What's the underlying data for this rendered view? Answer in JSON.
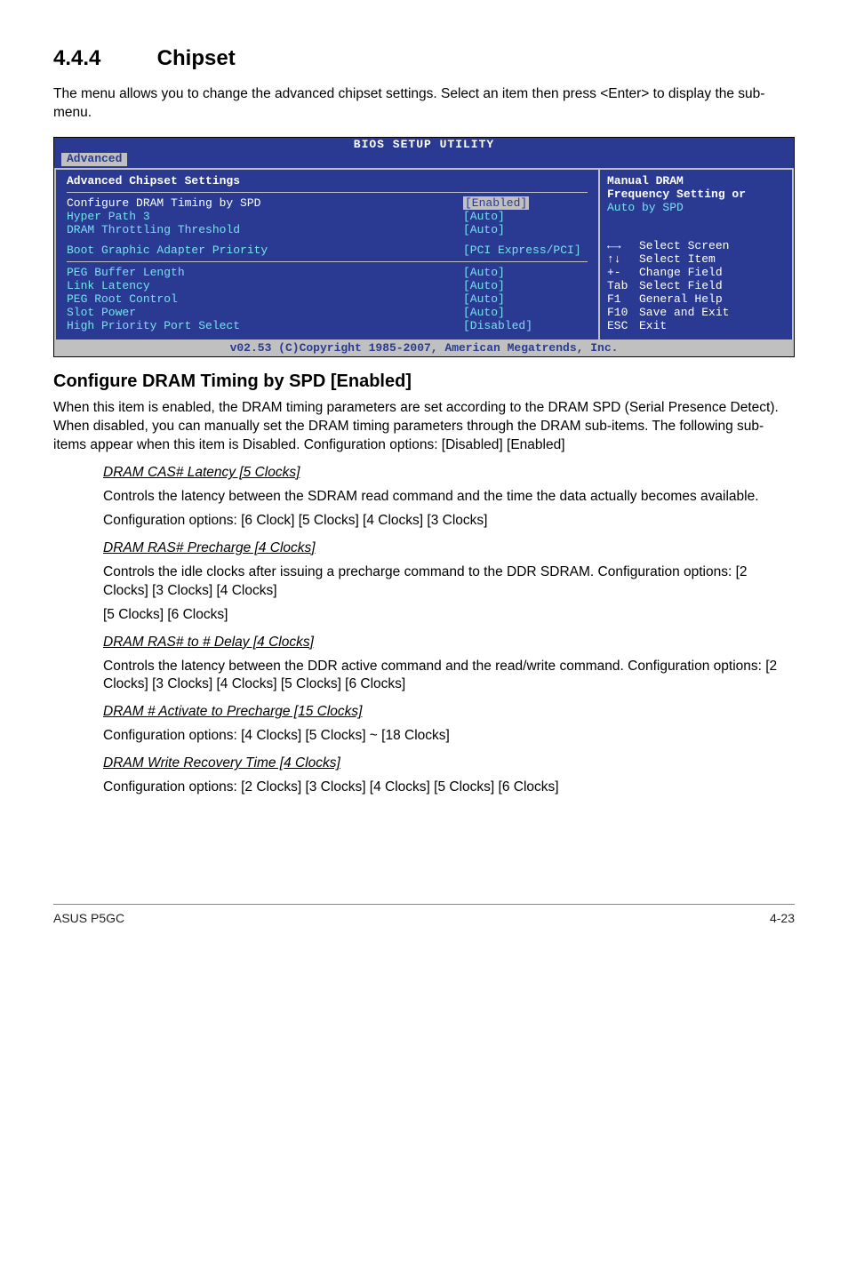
{
  "section": {
    "num": "4.4.4",
    "title": "Chipset"
  },
  "intro": "The menu allows you to change the advanced chipset settings. Select an item then press <Enter> to display the sub-menu.",
  "bios": {
    "title": "BIOS SETUP UTILITY",
    "tab": "Advanced",
    "panel_heading": "Advanced Chipset Settings",
    "top": [
      {
        "label": "Configure DRAM Timing by SPD",
        "value": "[Enabled]",
        "hl": true
      },
      {
        "label": "Hyper Path 3",
        "value": "[Auto]"
      },
      {
        "label": "DRAM Throttling Threshold",
        "value": "[Auto]"
      }
    ],
    "boot": {
      "label": "Boot Graphic Adapter Priority",
      "value": "[PCI Express/PCI]"
    },
    "bottom": [
      {
        "label": "PEG Buffer Length",
        "value": "[Auto]"
      },
      {
        "label": "Link Latency",
        "value": "[Auto]"
      },
      {
        "label": "PEG Root Control",
        "value": "[Auto]"
      },
      {
        "label": "Slot Power",
        "value": "[Auto]"
      },
      {
        "label": "High Priority Port Select",
        "value": "[Disabled]"
      }
    ],
    "help": {
      "l1": "Manual DRAM",
      "l2": "Frequency Setting or",
      "l3": "Auto by SPD"
    },
    "keys": [
      {
        "k": "←→",
        "d": "Select Screen"
      },
      {
        "k": "↑↓",
        "d": "Select Item"
      },
      {
        "k": "+-",
        "d": "Change Field"
      },
      {
        "k": "Tab",
        "d": "Select Field"
      },
      {
        "k": "F1",
        "d": "General Help"
      },
      {
        "k": "F10",
        "d": "Save and Exit"
      },
      {
        "k": "ESC",
        "d": "Exit"
      }
    ],
    "footer": "v02.53 (C)Copyright 1985-2007, American Megatrends, Inc."
  },
  "subheading": "Configure DRAM Timing by SPD [Enabled]",
  "subpara": "When this item is enabled, the DRAM timing parameters are set according to the DRAM SPD (Serial Presence Detect). When disabled, you can manually set the DRAM timing parameters through the DRAM sub-items. The following sub-items appear when this item is Disabled.  Configuration options: [Disabled] [Enabled]",
  "items": [
    {
      "title": "DRAM CAS# Latency [5 Clocks]",
      "body": [
        "Controls the latency between the SDRAM read command and the time the data actually becomes available.",
        "Configuration options: [6 Clock] [5 Clocks] [4 Clocks] [3 Clocks]"
      ]
    },
    {
      "title": "DRAM RAS# Precharge [4 Clocks]",
      "body": [
        "Controls the idle clocks after issuing a precharge command to the DDR SDRAM. Configuration options: [2 Clocks] [3 Clocks] [4 Clocks]",
        "[5 Clocks] [6 Clocks]"
      ]
    },
    {
      "title": "DRAM RAS# to  # Delay [4 Clocks]",
      "body": [
        "Controls the latency between the DDR   active command and the read/write command. Configuration options: [2 Clocks] [3 Clocks]  [4 Clocks] [5 Clocks] [6 Clocks]"
      ]
    },
    {
      "title": "DRAM  # Activate to Precharge [15 Clocks]",
      "body": [
        "Configuration options: [4 Clocks] [5 Clocks] ~ [18 Clocks]"
      ]
    },
    {
      "title": "DRAM Write Recovery Time [4 Clocks]",
      "body": [
        "Configuration options: [2 Clocks] [3 Clocks] [4 Clocks] [5 Clocks] [6 Clocks]"
      ]
    }
  ],
  "footer": {
    "left": "ASUS P5GC",
    "right": "4-23"
  }
}
